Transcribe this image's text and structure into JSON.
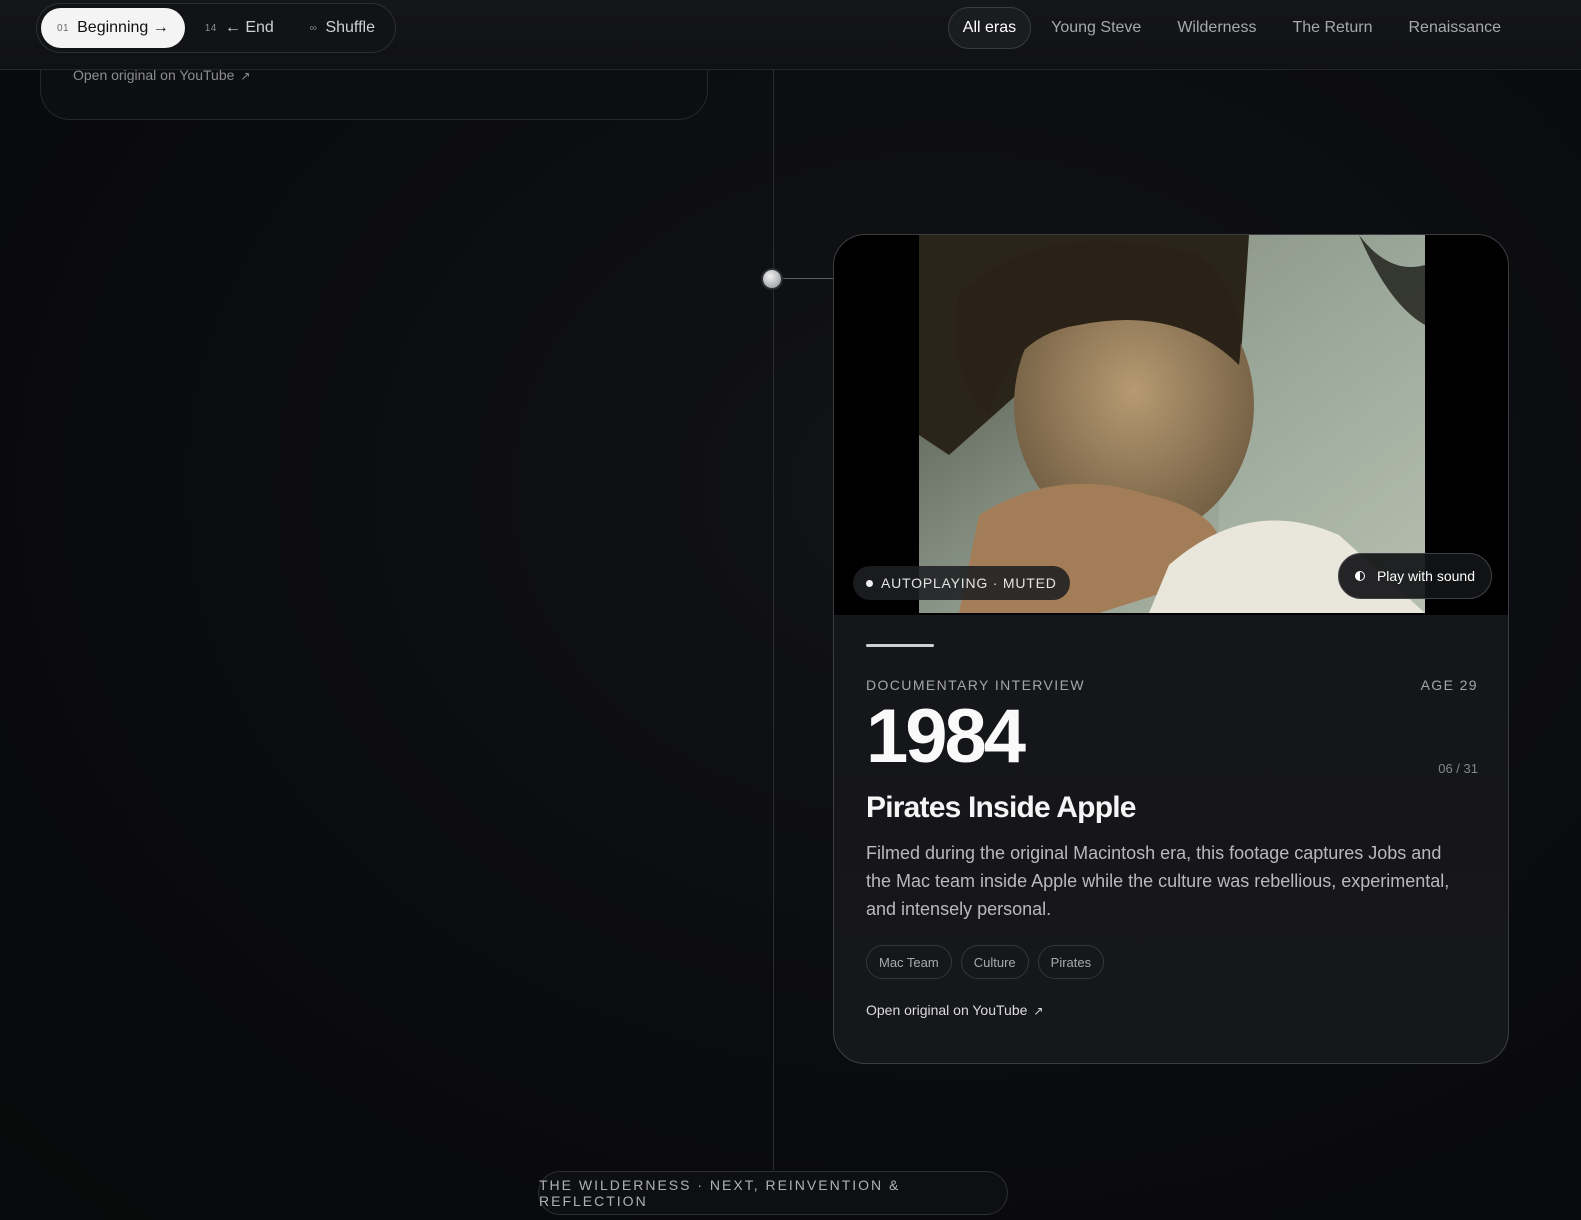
{
  "topnav": {
    "buttons": [
      {
        "num": "01",
        "label": "Beginning →"
      },
      {
        "num": "14",
        "label": "← End"
      },
      {
        "num": "∞",
        "label": "Shuffle"
      }
    ]
  },
  "eras": [
    "All eras",
    "Young Steve",
    "Wilderness",
    "The Return",
    "Renaissance"
  ],
  "previous_card": {
    "link": "Open original on YouTube"
  },
  "card": {
    "badge": "AUTOPLAYING · MUTED",
    "sound_button": "Play with sound",
    "kind": "DOCUMENTARY INTERVIEW",
    "age": "AGE 29",
    "year": "1984",
    "index": "06 / 31",
    "title": "Pirates Inside Apple",
    "description": "Filmed during the original Macintosh era, this footage captures Jobs and the Mac team inside Apple while the culture was rebellious, experimental, and intensely personal.",
    "tags": [
      "Mac Team",
      "Culture",
      "Pirates"
    ],
    "link": "Open original on YouTube",
    "link_arrow": "↗"
  },
  "footer": {
    "label": "THE WILDERNESS · NEXT, REINVENTION & REFLECTION"
  }
}
